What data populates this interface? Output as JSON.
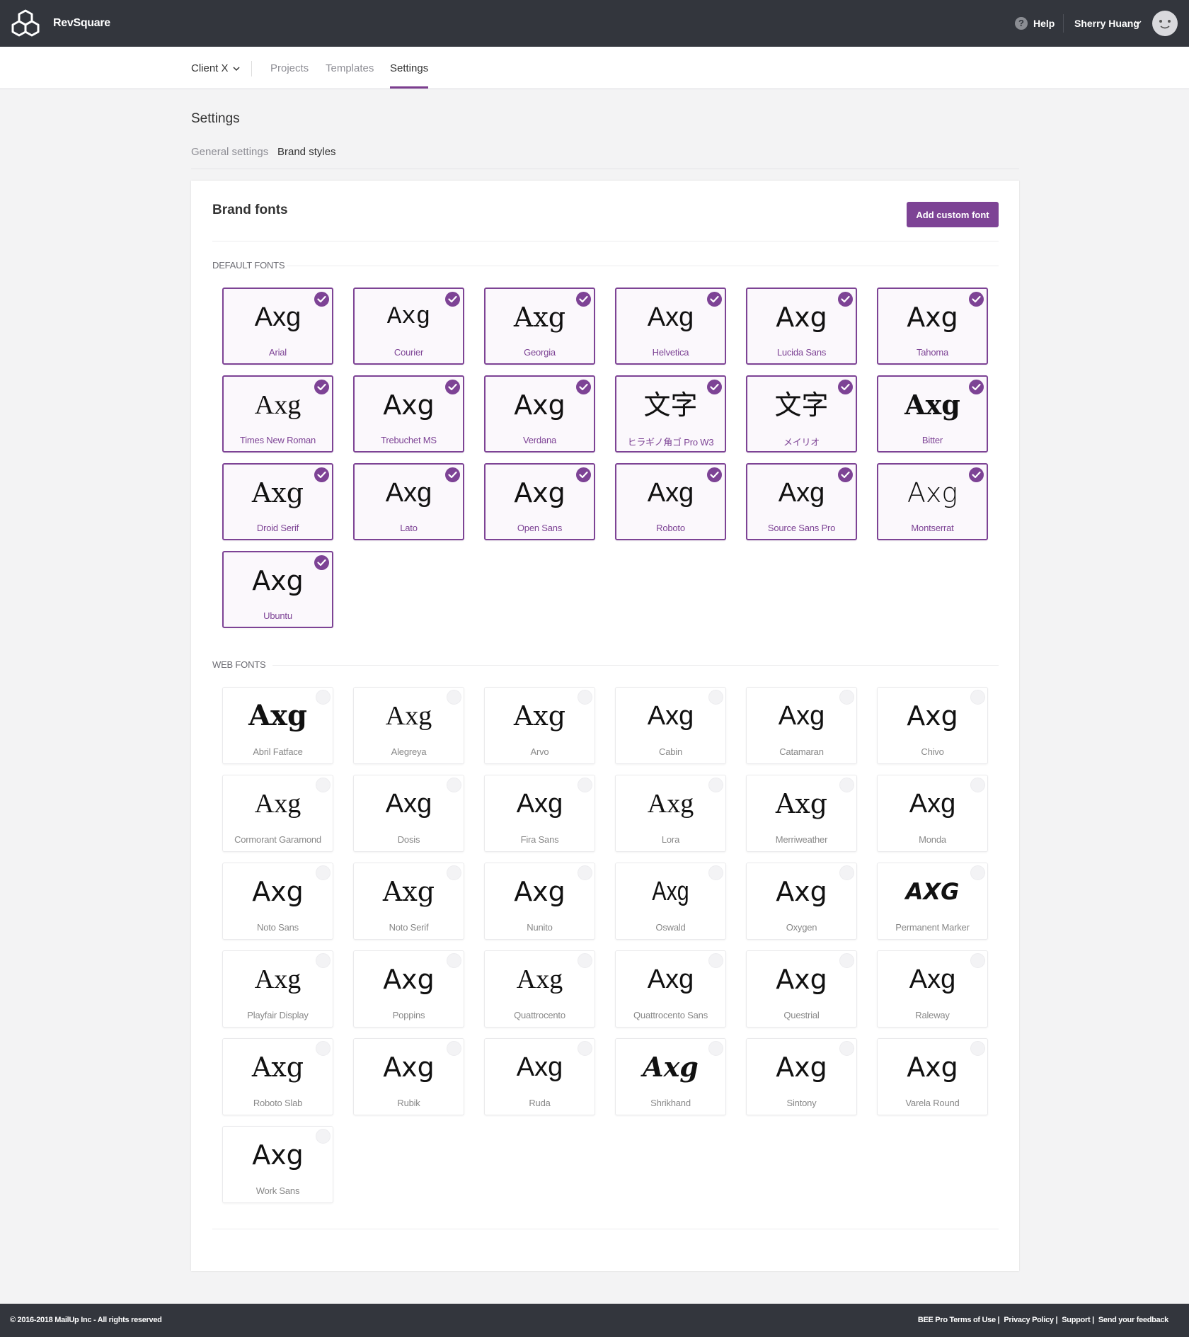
{
  "app": {
    "brand": "RevSquare"
  },
  "header": {
    "help_label": "Help",
    "user_name": "Sherry Huang"
  },
  "subnav": {
    "client": "Client X",
    "links": [
      {
        "label": "Projects"
      },
      {
        "label": "Templates"
      },
      {
        "label": "Settings",
        "active": true
      }
    ]
  },
  "page": {
    "title": "Settings",
    "tabs": [
      {
        "label": "General settings"
      },
      {
        "label": "Brand styles",
        "active": true
      }
    ]
  },
  "brand_fonts": {
    "title": "Brand fonts",
    "add_button": "Add custom font",
    "default_section": "DEFAULT FONTS",
    "web_section": "WEB FONTS",
    "sample_text": "Axg",
    "default_fonts": [
      {
        "name": "Arial",
        "sample": "Axg",
        "selected": true
      },
      {
        "name": "Courier",
        "sample": "Axg",
        "selected": true
      },
      {
        "name": "Georgia",
        "sample": "Axg",
        "selected": true
      },
      {
        "name": "Helvetica",
        "sample": "Axg",
        "selected": true
      },
      {
        "name": "Lucida Sans",
        "sample": "Axg",
        "selected": true
      },
      {
        "name": "Tahoma",
        "sample": "Axg",
        "selected": true
      },
      {
        "name": "Times New Roman",
        "sample": "Axg",
        "selected": true
      },
      {
        "name": "Trebuchet MS",
        "sample": "Axg",
        "selected": true
      },
      {
        "name": "Verdana",
        "sample": "Axg",
        "selected": true
      },
      {
        "name": "ヒラギノ角ゴ Pro W3",
        "sample": "文字",
        "selected": true
      },
      {
        "name": "メイリオ",
        "sample": "文字",
        "selected": true
      },
      {
        "name": "Bitter",
        "sample": "Axg",
        "selected": true
      },
      {
        "name": "Droid Serif",
        "sample": "Axg",
        "selected": true
      },
      {
        "name": "Lato",
        "sample": "Axg",
        "selected": true
      },
      {
        "name": "Open Sans",
        "sample": "Axg",
        "selected": true
      },
      {
        "name": "Roboto",
        "sample": "Axg",
        "selected": true
      },
      {
        "name": "Source Sans Pro",
        "sample": "Axg",
        "selected": true
      },
      {
        "name": "Montserrat",
        "sample": "Axg",
        "selected": true
      },
      {
        "name": "Ubuntu",
        "sample": "Axg",
        "selected": true
      }
    ],
    "web_fonts": [
      {
        "name": "Abril Fatface",
        "sample": "Axg",
        "selected": false
      },
      {
        "name": "Alegreya",
        "sample": "Axg",
        "selected": false
      },
      {
        "name": "Arvo",
        "sample": "Axg",
        "selected": false
      },
      {
        "name": "Cabin",
        "sample": "Axg",
        "selected": false
      },
      {
        "name": "Catamaran",
        "sample": "Axg",
        "selected": false
      },
      {
        "name": "Chivo",
        "sample": "Axg",
        "selected": false
      },
      {
        "name": "Cormorant Garamond",
        "sample": "Axg",
        "selected": false
      },
      {
        "name": "Dosis",
        "sample": "Axg",
        "selected": false
      },
      {
        "name": "Fira Sans",
        "sample": "Axg",
        "selected": false
      },
      {
        "name": "Lora",
        "sample": "Axg",
        "selected": false
      },
      {
        "name": "Merriweather",
        "sample": "Axg",
        "selected": false
      },
      {
        "name": "Monda",
        "sample": "Axg",
        "selected": false
      },
      {
        "name": "Noto Sans",
        "sample": "Axg",
        "selected": false
      },
      {
        "name": "Noto Serif",
        "sample": "Axg",
        "selected": false
      },
      {
        "name": "Nunito",
        "sample": "Axg",
        "selected": false
      },
      {
        "name": "Oswald",
        "sample": "Axg",
        "selected": false
      },
      {
        "name": "Oxygen",
        "sample": "Axg",
        "selected": false
      },
      {
        "name": "Permanent Marker",
        "sample": "AXG",
        "selected": false
      },
      {
        "name": "Playfair Display",
        "sample": "Axg",
        "selected": false
      },
      {
        "name": "Poppins",
        "sample": "Axg",
        "selected": false
      },
      {
        "name": "Quattrocento",
        "sample": "Axg",
        "selected": false
      },
      {
        "name": "Quattrocento Sans",
        "sample": "Axg",
        "selected": false
      },
      {
        "name": "Questrial",
        "sample": "Axg",
        "selected": false
      },
      {
        "name": "Raleway",
        "sample": "Axg",
        "selected": false
      },
      {
        "name": "Roboto Slab",
        "sample": "Axg",
        "selected": false
      },
      {
        "name": "Rubik",
        "sample": "Axg",
        "selected": false
      },
      {
        "name": "Ruda",
        "sample": "Axg",
        "selected": false
      },
      {
        "name": "Shrikhand",
        "sample": "Axg",
        "selected": false
      },
      {
        "name": "Sintony",
        "sample": "Axg",
        "selected": false
      },
      {
        "name": "Varela Round",
        "sample": "Axg",
        "selected": false
      },
      {
        "name": "Work Sans",
        "sample": "Axg",
        "selected": false
      }
    ]
  },
  "footer": {
    "copyright": "© 2016-2018 MailUp Inc - All rights reserved",
    "links": [
      "BEE Pro Terms of Use |",
      "Privacy Policy |",
      "Support |",
      "Send your feedback"
    ]
  },
  "colors": {
    "accent": "#7d4395",
    "topbar": "#33363d",
    "background": "#f3f3f4"
  },
  "icons": {
    "logo": "cube-logo-icon",
    "help": "help-icon",
    "chevron": "chevron-down-icon",
    "avatar": "avatar-face-icon",
    "check": "check-circle-icon"
  }
}
